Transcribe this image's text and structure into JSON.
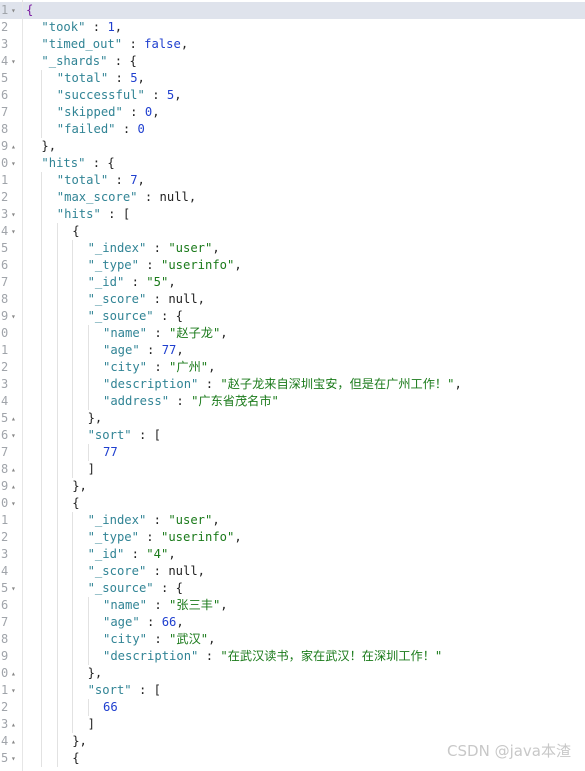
{
  "editor": {
    "active_line": 1,
    "lines": [
      {
        "n": "1",
        "fold": "down",
        "indent": 0,
        "tokens": [
          [
            "p",
            "{"
          ]
        ]
      },
      {
        "n": "2",
        "indent": 1,
        "tokens": [
          [
            "k",
            "\"took\""
          ],
          [
            "p",
            " : "
          ],
          [
            "n",
            "1"
          ],
          [
            "p",
            ","
          ]
        ]
      },
      {
        "n": "3",
        "indent": 1,
        "tokens": [
          [
            "k",
            "\"timed_out\""
          ],
          [
            "p",
            " : "
          ],
          [
            "b",
            "false"
          ],
          [
            "p",
            ","
          ]
        ]
      },
      {
        "n": "4",
        "fold": "down",
        "indent": 1,
        "tokens": [
          [
            "k",
            "\"_shards\""
          ],
          [
            "p",
            " : {"
          ]
        ]
      },
      {
        "n": "5",
        "indent": 2,
        "tokens": [
          [
            "k",
            "\"total\""
          ],
          [
            "p",
            " : "
          ],
          [
            "n",
            "5"
          ],
          [
            "p",
            ","
          ]
        ]
      },
      {
        "n": "6",
        "indent": 2,
        "tokens": [
          [
            "k",
            "\"successful\""
          ],
          [
            "p",
            " : "
          ],
          [
            "n",
            "5"
          ],
          [
            "p",
            ","
          ]
        ]
      },
      {
        "n": "7",
        "indent": 2,
        "tokens": [
          [
            "k",
            "\"skipped\""
          ],
          [
            "p",
            " : "
          ],
          [
            "n",
            "0"
          ],
          [
            "p",
            ","
          ]
        ]
      },
      {
        "n": "8",
        "indent": 2,
        "tokens": [
          [
            "k",
            "\"failed\""
          ],
          [
            "p",
            " : "
          ],
          [
            "n",
            "0"
          ]
        ]
      },
      {
        "n": "9",
        "fold": "up",
        "indent": 1,
        "tokens": [
          [
            "p",
            "},"
          ]
        ]
      },
      {
        "n": "0",
        "fold": "down",
        "indent": 1,
        "tokens": [
          [
            "k",
            "\"hits\""
          ],
          [
            "p",
            " : {"
          ]
        ]
      },
      {
        "n": "1",
        "indent": 2,
        "tokens": [
          [
            "k",
            "\"total\""
          ],
          [
            "p",
            " : "
          ],
          [
            "n",
            "7"
          ],
          [
            "p",
            ","
          ]
        ]
      },
      {
        "n": "2",
        "indent": 2,
        "tokens": [
          [
            "k",
            "\"max_score\""
          ],
          [
            "p",
            " : "
          ],
          [
            "nl",
            "null"
          ],
          [
            "p",
            ","
          ]
        ]
      },
      {
        "n": "3",
        "fold": "down",
        "indent": 2,
        "tokens": [
          [
            "k",
            "\"hits\""
          ],
          [
            "p",
            " : ["
          ]
        ]
      },
      {
        "n": "4",
        "fold": "down",
        "indent": 3,
        "tokens": [
          [
            "p",
            "{"
          ]
        ]
      },
      {
        "n": "5",
        "indent": 4,
        "tokens": [
          [
            "k",
            "\"_index\""
          ],
          [
            "p",
            " : "
          ],
          [
            "s",
            "\"user\""
          ],
          [
            "p",
            ","
          ]
        ]
      },
      {
        "n": "6",
        "indent": 4,
        "tokens": [
          [
            "k",
            "\"_type\""
          ],
          [
            "p",
            " : "
          ],
          [
            "s",
            "\"userinfo\""
          ],
          [
            "p",
            ","
          ]
        ]
      },
      {
        "n": "7",
        "indent": 4,
        "tokens": [
          [
            "k",
            "\"_id\""
          ],
          [
            "p",
            " : "
          ],
          [
            "s",
            "\"5\""
          ],
          [
            "p",
            ","
          ]
        ]
      },
      {
        "n": "8",
        "indent": 4,
        "tokens": [
          [
            "k",
            "\"_score\""
          ],
          [
            "p",
            " : "
          ],
          [
            "nl",
            "null"
          ],
          [
            "p",
            ","
          ]
        ]
      },
      {
        "n": "9",
        "fold": "down",
        "indent": 4,
        "tokens": [
          [
            "k",
            "\"_source\""
          ],
          [
            "p",
            " : {"
          ]
        ]
      },
      {
        "n": "0",
        "indent": 5,
        "tokens": [
          [
            "k",
            "\"name\""
          ],
          [
            "p",
            " : "
          ],
          [
            "s",
            "\"赵子龙\""
          ],
          [
            "p",
            ","
          ]
        ]
      },
      {
        "n": "1",
        "indent": 5,
        "tokens": [
          [
            "k",
            "\"age\""
          ],
          [
            "p",
            " : "
          ],
          [
            "n",
            "77"
          ],
          [
            "p",
            ","
          ]
        ]
      },
      {
        "n": "2",
        "indent": 5,
        "tokens": [
          [
            "k",
            "\"city\""
          ],
          [
            "p",
            " : "
          ],
          [
            "s",
            "\"广州\""
          ],
          [
            "p",
            ","
          ]
        ]
      },
      {
        "n": "3",
        "indent": 5,
        "tokens": [
          [
            "k",
            "\"description\""
          ],
          [
            "p",
            " : "
          ],
          [
            "s",
            "\"赵子龙来自深圳宝安，但是在广州工作！\""
          ],
          [
            "p",
            ","
          ]
        ]
      },
      {
        "n": "4",
        "indent": 5,
        "tokens": [
          [
            "k",
            "\"address\""
          ],
          [
            "p",
            " : "
          ],
          [
            "s",
            "\"广东省茂名市\""
          ]
        ]
      },
      {
        "n": "5",
        "fold": "up",
        "indent": 4,
        "tokens": [
          [
            "p",
            "},"
          ]
        ]
      },
      {
        "n": "6",
        "fold": "down",
        "indent": 4,
        "tokens": [
          [
            "k",
            "\"sort\""
          ],
          [
            "p",
            " : ["
          ]
        ]
      },
      {
        "n": "7",
        "indent": 5,
        "tokens": [
          [
            "n",
            "77"
          ]
        ]
      },
      {
        "n": "8",
        "fold": "up",
        "indent": 4,
        "tokens": [
          [
            "p",
            "]"
          ]
        ]
      },
      {
        "n": "9",
        "fold": "up",
        "indent": 3,
        "tokens": [
          [
            "p",
            "},"
          ]
        ]
      },
      {
        "n": "0",
        "fold": "down",
        "indent": 3,
        "tokens": [
          [
            "p",
            "{"
          ]
        ]
      },
      {
        "n": "1",
        "indent": 4,
        "tokens": [
          [
            "k",
            "\"_index\""
          ],
          [
            "p",
            " : "
          ],
          [
            "s",
            "\"user\""
          ],
          [
            "p",
            ","
          ]
        ]
      },
      {
        "n": "2",
        "indent": 4,
        "tokens": [
          [
            "k",
            "\"_type\""
          ],
          [
            "p",
            " : "
          ],
          [
            "s",
            "\"userinfo\""
          ],
          [
            "p",
            ","
          ]
        ]
      },
      {
        "n": "3",
        "indent": 4,
        "tokens": [
          [
            "k",
            "\"_id\""
          ],
          [
            "p",
            " : "
          ],
          [
            "s",
            "\"4\""
          ],
          [
            "p",
            ","
          ]
        ]
      },
      {
        "n": "4",
        "indent": 4,
        "tokens": [
          [
            "k",
            "\"_score\""
          ],
          [
            "p",
            " : "
          ],
          [
            "nl",
            "null"
          ],
          [
            "p",
            ","
          ]
        ]
      },
      {
        "n": "5",
        "fold": "down",
        "indent": 4,
        "tokens": [
          [
            "k",
            "\"_source\""
          ],
          [
            "p",
            " : {"
          ]
        ]
      },
      {
        "n": "6",
        "indent": 5,
        "tokens": [
          [
            "k",
            "\"name\""
          ],
          [
            "p",
            " : "
          ],
          [
            "s",
            "\"张三丰\""
          ],
          [
            "p",
            ","
          ]
        ]
      },
      {
        "n": "7",
        "indent": 5,
        "tokens": [
          [
            "k",
            "\"age\""
          ],
          [
            "p",
            " : "
          ],
          [
            "n",
            "66"
          ],
          [
            "p",
            ","
          ]
        ]
      },
      {
        "n": "8",
        "indent": 5,
        "tokens": [
          [
            "k",
            "\"city\""
          ],
          [
            "p",
            " : "
          ],
          [
            "s",
            "\"武汉\""
          ],
          [
            "p",
            ","
          ]
        ]
      },
      {
        "n": "9",
        "indent": 5,
        "tokens": [
          [
            "k",
            "\"description\""
          ],
          [
            "p",
            " : "
          ],
          [
            "s",
            "\"在武汉读书，家在武汉！在深圳工作！\""
          ]
        ]
      },
      {
        "n": "0",
        "fold": "up",
        "indent": 4,
        "tokens": [
          [
            "p",
            "},"
          ]
        ]
      },
      {
        "n": "1",
        "fold": "down",
        "indent": 4,
        "tokens": [
          [
            "k",
            "\"sort\""
          ],
          [
            "p",
            " : ["
          ]
        ]
      },
      {
        "n": "2",
        "indent": 5,
        "tokens": [
          [
            "n",
            "66"
          ]
        ]
      },
      {
        "n": "3",
        "fold": "up",
        "indent": 4,
        "tokens": [
          [
            "p",
            "]"
          ]
        ]
      },
      {
        "n": "4",
        "fold": "up",
        "indent": 3,
        "tokens": [
          [
            "p",
            "},"
          ]
        ]
      },
      {
        "n": "5",
        "fold": "down",
        "indent": 3,
        "tokens": [
          [
            "p",
            "{"
          ]
        ]
      }
    ]
  },
  "watermark": "CSDN @java本渣",
  "icons": {
    "fold_down": "▾",
    "fold_up": "▴"
  }
}
